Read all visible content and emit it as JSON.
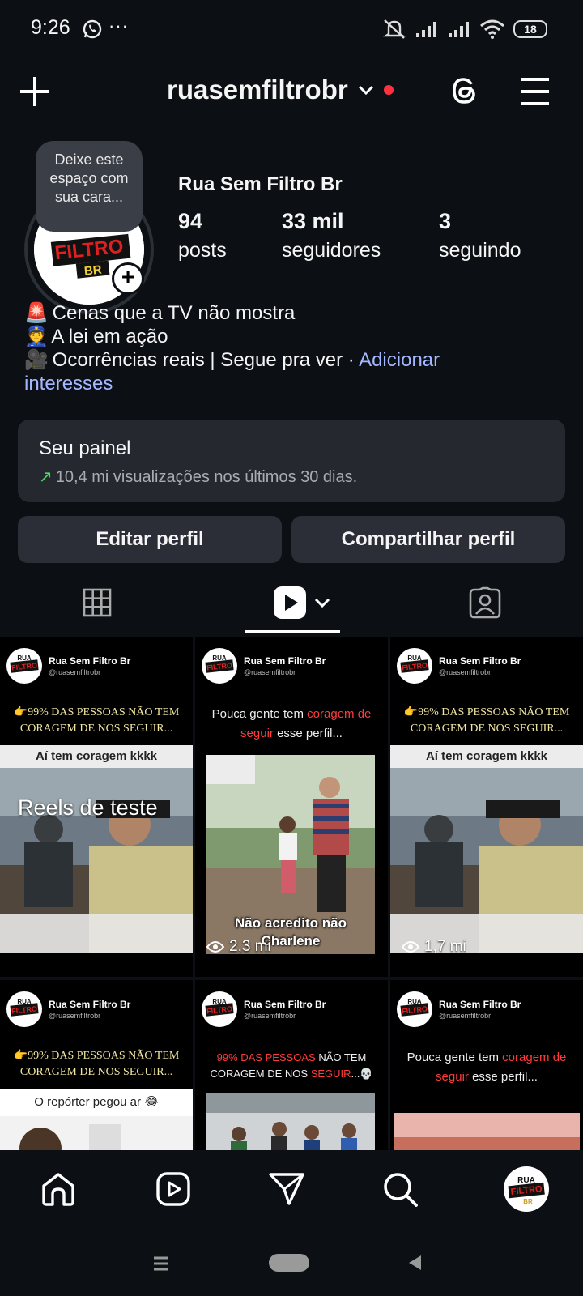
{
  "status_bar": {
    "time": "9:26",
    "battery": "18",
    "more_indicator": "···"
  },
  "header": {
    "username": "ruasemfiltrobr"
  },
  "profile": {
    "note": "Deixe este espaço com sua cara...",
    "name": "Rua Sem Filtro Br",
    "stats": [
      {
        "value": "94",
        "label": "posts"
      },
      {
        "value": "33 mil",
        "label": "seguidores"
      },
      {
        "value": "3",
        "label": "seguindo"
      }
    ],
    "bio": {
      "line1_emoji": "🚨",
      "line1": "Cenas que a TV não mostra",
      "line2_emoji": "👮",
      "line2": "A lei em ação",
      "line3_emoji": "🎥",
      "line3": "Ocorrências reais | Segue pra ver ·",
      "link_part1": "Adicionar",
      "link_part2": "interesses"
    }
  },
  "panel": {
    "title": "Seu painel",
    "subtitle": "10,4 mi visualizações nos últimos 30 dias."
  },
  "buttons": {
    "edit": "Editar perfil",
    "share": "Compartilhar perfil"
  },
  "logo": {
    "text_rua": "RUA",
    "text_filtro": "FILTRO",
    "text_br": "BR"
  },
  "grid": {
    "account_name": "Rua Sem Filtro Br",
    "account_handle": "@ruasemfiltrobr",
    "cells": [
      {
        "caption": "👉99% DAS PESSOAS NÃO TEM CORAGEM DE NOS SEGUIR...",
        "strip": "Aí tem coragem kkkk",
        "overlay": "Reels de teste"
      },
      {
        "caption_pre": "Pouca gente tem ",
        "caption_red": "coragem de seguir",
        "caption_post": " esse perfil...",
        "video_text1": "Não acredito não",
        "video_text2": "Charlene",
        "views": "2,3 mi"
      },
      {
        "caption": "👉99% DAS PESSOAS NÃO TEM CORAGEM DE NOS SEGUIR...",
        "strip": "Aí tem coragem kkkk",
        "views": "1,7 mi"
      },
      {
        "caption": "👉99% DAS PESSOAS NÃO TEM CORAGEM DE NOS SEGUIR...",
        "strip": "O repórter pegou ar 😂"
      },
      {
        "caption_red1": "99% DAS PESSOAS",
        "caption_mid": " NÃO TEM CORAGEM DE NOS ",
        "caption_red2": "SEGUIR",
        "caption_end": "...💀"
      },
      {
        "caption_pre": "Pouca gente tem ",
        "caption_red": "coragem de seguir",
        "caption_post": " esse perfil..."
      }
    ]
  },
  "colors": {
    "background": "#0c0f14",
    "surface": "#25282f",
    "link": "#a4b8ff",
    "notification_dot": "#ff3040",
    "trend_up": "#4cd964"
  }
}
